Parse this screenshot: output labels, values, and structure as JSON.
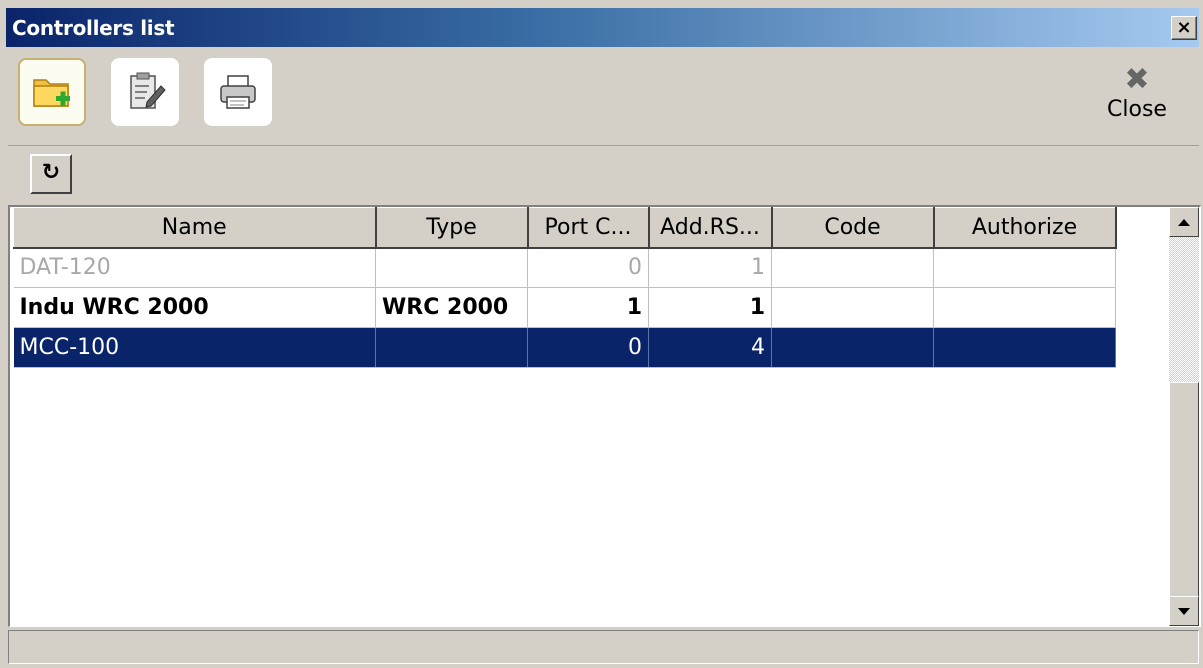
{
  "window": {
    "title": "Controllers list",
    "close_glyph": "×"
  },
  "toolbar": {
    "buttons": [
      {
        "name": "add-folder-icon"
      },
      {
        "name": "edit-clipboard-icon"
      },
      {
        "name": "printer-icon"
      }
    ],
    "close_glyph": "✖",
    "close_label": "Close"
  },
  "refresh": {
    "glyph": "↻"
  },
  "grid": {
    "columns": [
      "Name",
      "Type",
      "Port C...",
      "Add.RS...",
      "Code",
      "Authorize"
    ],
    "rows": [
      {
        "name": "DAT-120",
        "type": "",
        "port": "0",
        "addrs": "1",
        "code": "",
        "authorize": "",
        "state": "disabled"
      },
      {
        "name": "Indu WRC 2000",
        "type": "WRC 2000",
        "port": "1",
        "addrs": "1",
        "code": "",
        "authorize": "",
        "state": "bold"
      },
      {
        "name": "MCC-100",
        "type": "",
        "port": "0",
        "addrs": "4",
        "code": "",
        "authorize": "",
        "state": "selected"
      }
    ]
  },
  "status": {
    "text": ""
  }
}
